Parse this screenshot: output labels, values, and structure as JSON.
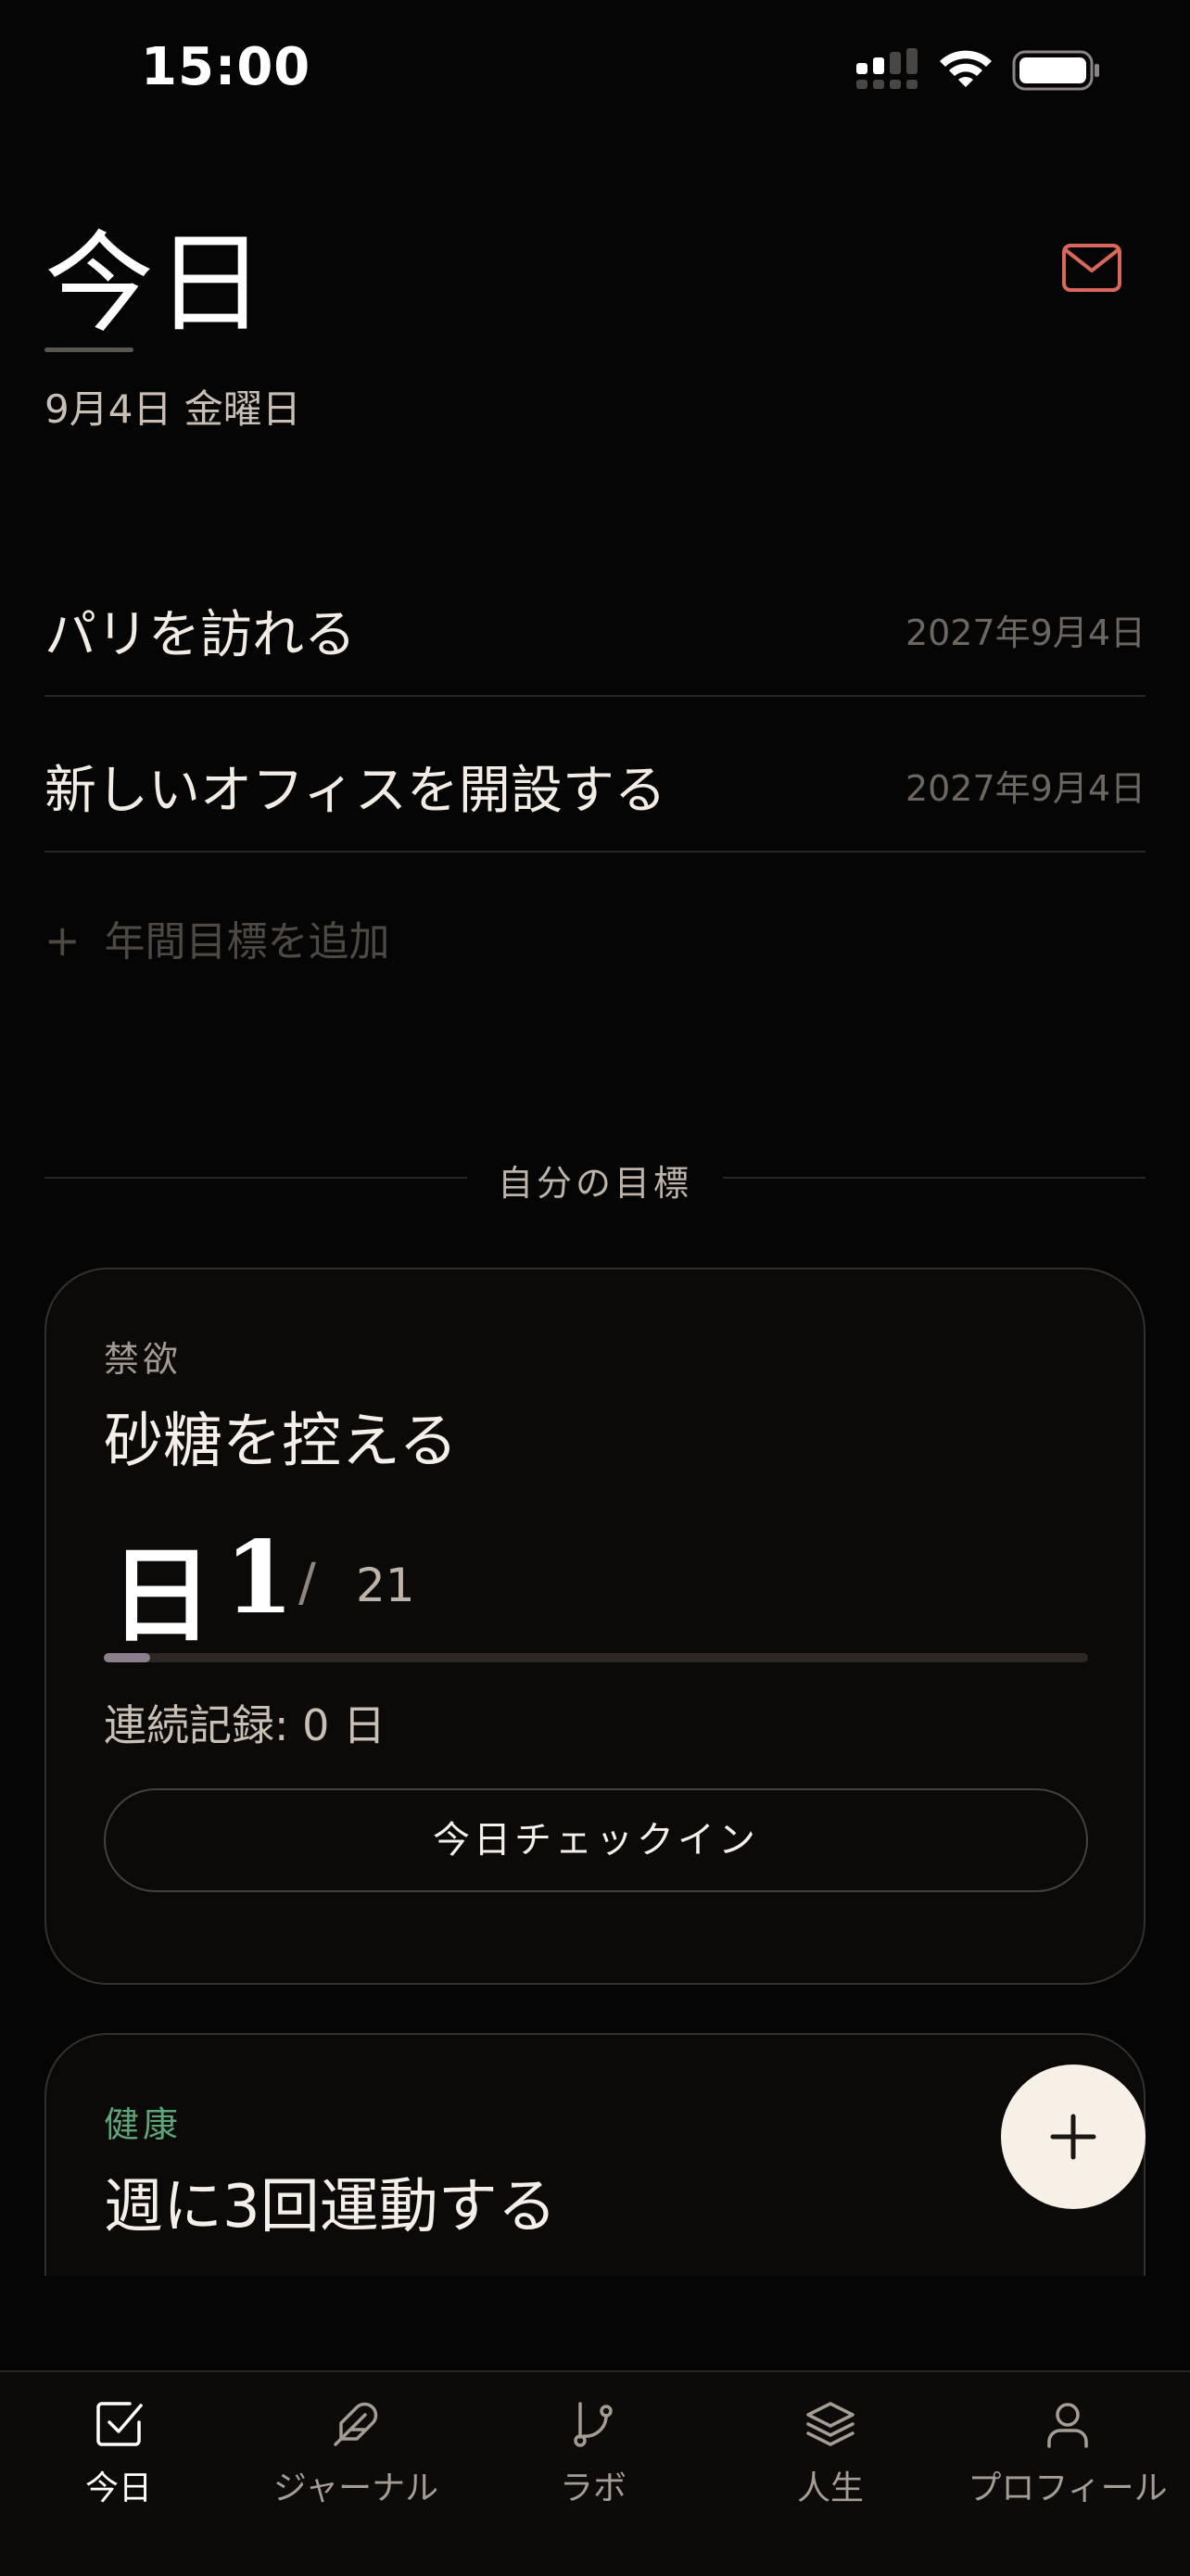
{
  "status_bar": {
    "time": "15:00"
  },
  "header": {
    "title": "今日",
    "date": "9月4日 金曜日"
  },
  "annual_goals": [
    {
      "title": "パリを訪れる",
      "date": "2027年9月4日"
    },
    {
      "title": "新しいオフィスを開設する",
      "date": "2027年9月4日"
    }
  ],
  "add_goal": {
    "plus": "+",
    "label": "年間目標を追加"
  },
  "section": {
    "title": "自分の目標"
  },
  "goal_cards": [
    {
      "category": "禁欲",
      "category_color": "#a39a92",
      "title": "砂糖を控える",
      "day_prefix": "日",
      "day_current": "1",
      "separator": "/",
      "day_total": "21",
      "progress_fraction": 0.047,
      "streak": "連続記録:  0 日",
      "checkin_label": "今日チェックイン"
    },
    {
      "category": "健康",
      "category_color": "#5fa57a",
      "title": "週に3回運動する"
    }
  ],
  "tabs": [
    {
      "label": "今日",
      "icon": "checkbox-icon",
      "active": true
    },
    {
      "label": "ジャーナル",
      "icon": "feather-icon",
      "active": false
    },
    {
      "label": "ラボ",
      "icon": "git-branch-icon",
      "active": false
    },
    {
      "label": "人生",
      "icon": "layers-icon",
      "active": false
    },
    {
      "label": "プロフィール",
      "icon": "user-icon",
      "active": false
    }
  ],
  "colors": {
    "accent": "#d9675a",
    "background": "#060505",
    "fab": "#f6f0e6"
  }
}
